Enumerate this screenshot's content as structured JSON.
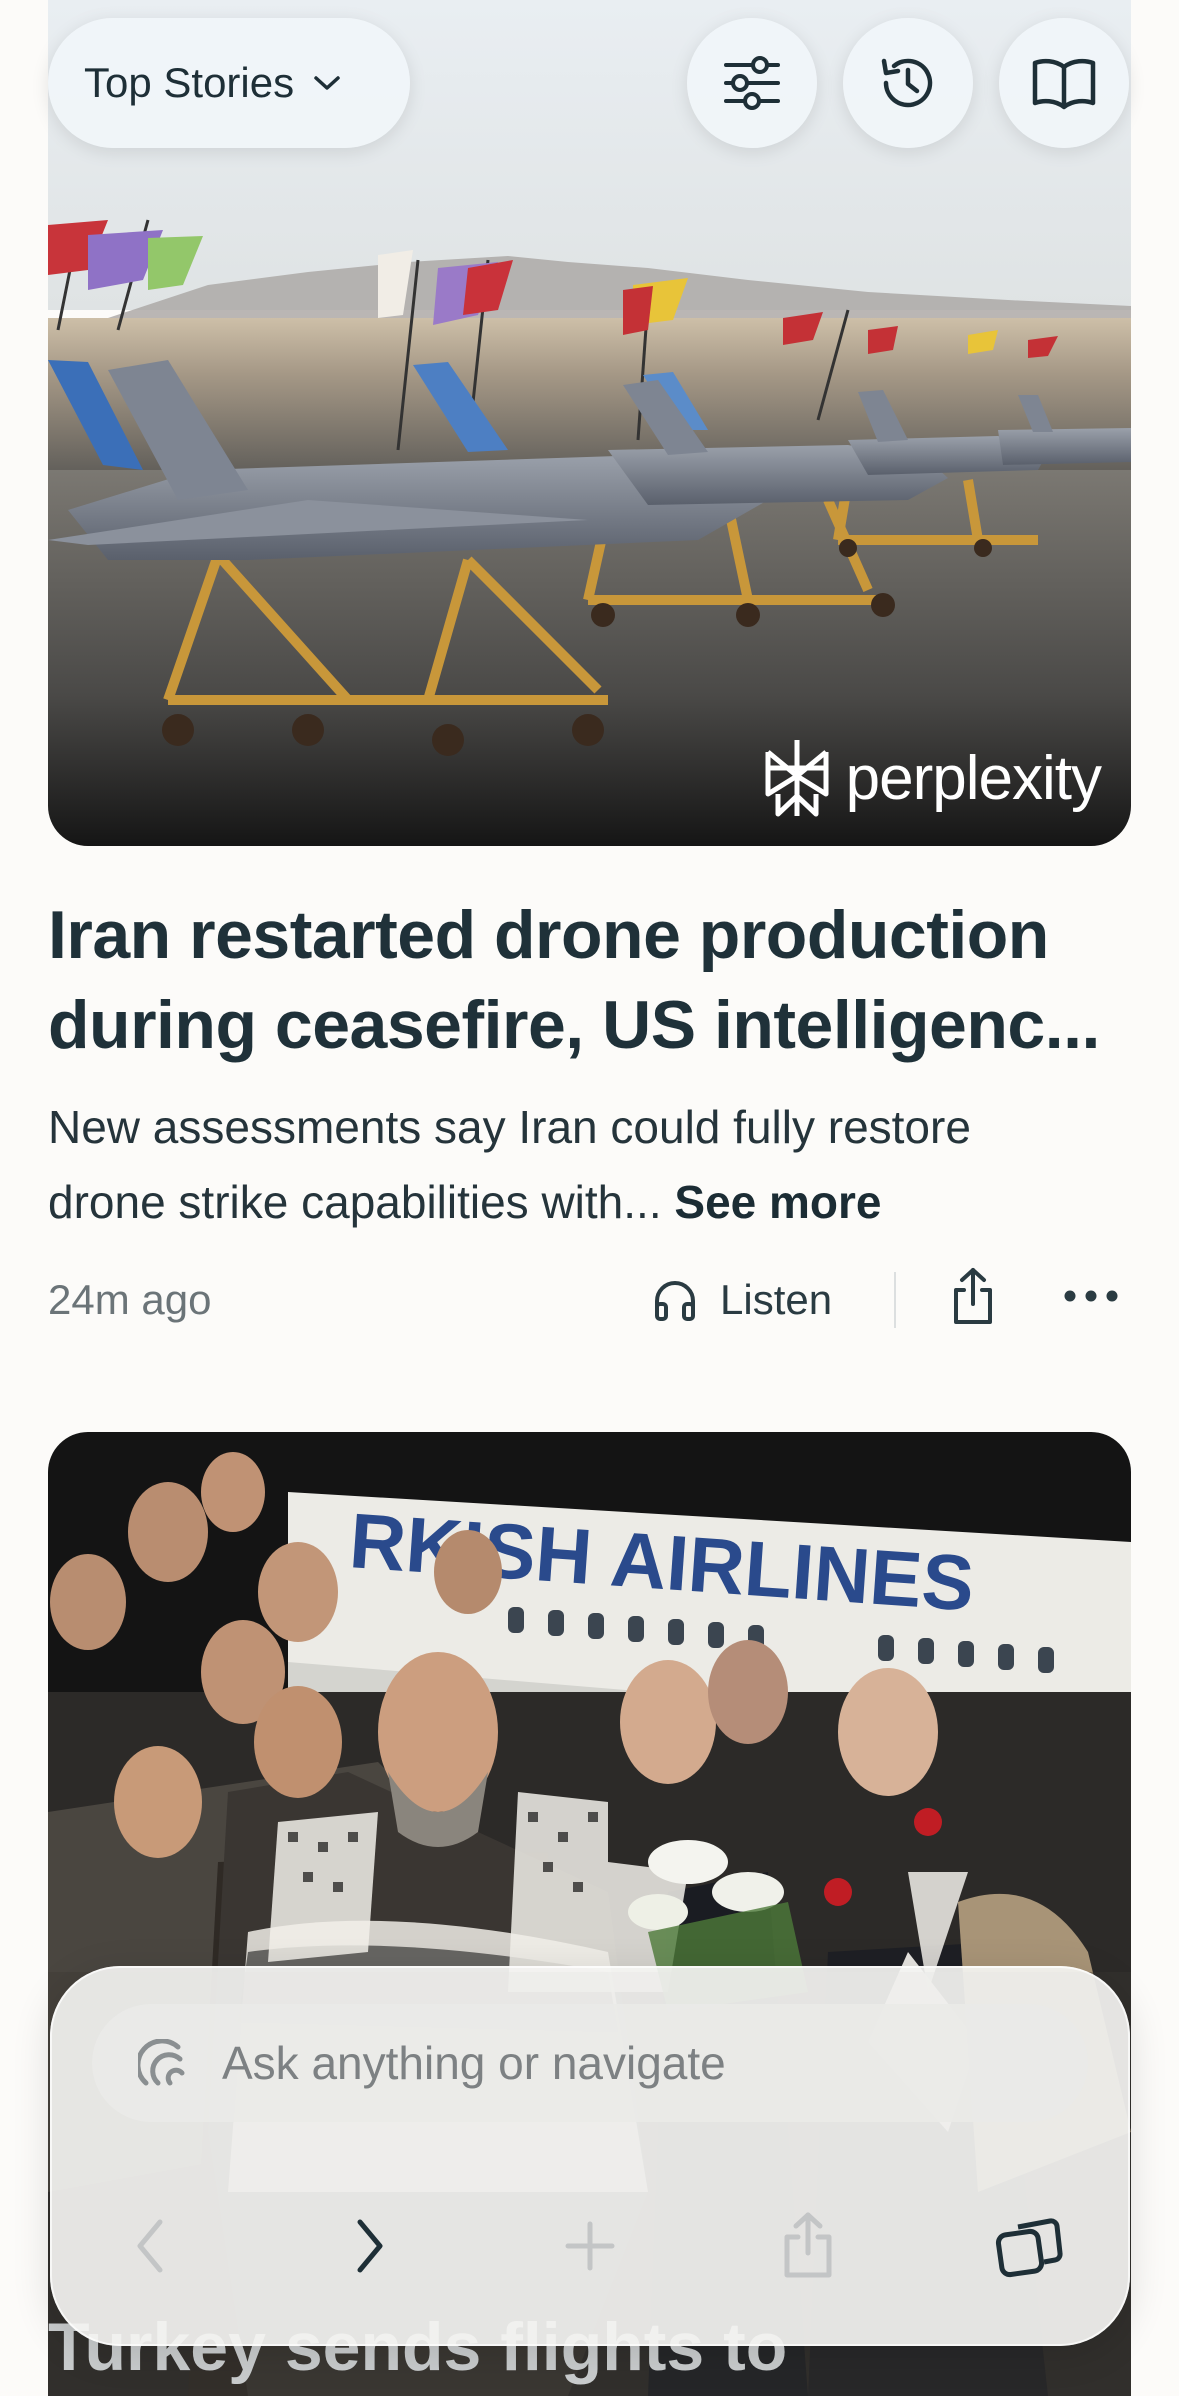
{
  "top_bar": {
    "feed_selector_label": "Top Stories",
    "icons": [
      "chevron-down-icon",
      "filter-sliders-icon",
      "history-icon",
      "library-book-icon"
    ]
  },
  "article_1": {
    "image_watermark": "perplexity",
    "headline_line1": "Iran restarted drone production",
    "headline_line2": "during ceasefire, US intelligenc...",
    "summary_line1": "New assessments say Iran could fully restore",
    "summary_line2": "drone strike capabilities with... ",
    "see_more_label": "See more",
    "timestamp": "24m ago",
    "listen_label": "Listen"
  },
  "article_2": {
    "image_text": "RKISH AIRLINES",
    "title_partial": "Turkey sends flights to"
  },
  "bottom_bar": {
    "search_placeholder": "Ask anything or navigate",
    "icons": [
      "back-arrow-icon",
      "forward-arrow-icon",
      "new-tab-plus-icon",
      "share-icon",
      "tabs-icon"
    ]
  },
  "colors": {
    "background": "#fcfbf9",
    "headline": "#1f3139",
    "muted": "#6b7478",
    "pill": "#f0f6f9"
  }
}
